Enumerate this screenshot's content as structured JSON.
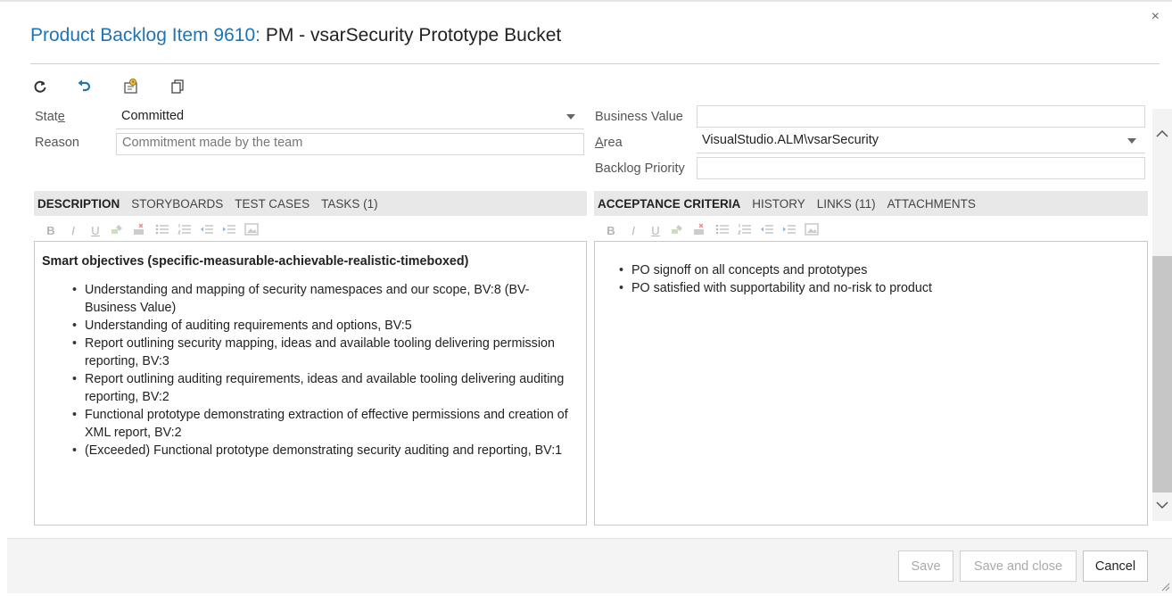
{
  "dialog": {
    "title_link": "Product Backlog Item 9610:",
    "title_rest": " PM - vsarSecurity Prototype Bucket",
    "close_glyph": "×"
  },
  "toolbar": {
    "icons": [
      "refresh-icon",
      "undo-icon",
      "history-icon",
      "copy-icon"
    ]
  },
  "fields": {
    "state": {
      "label_pre": "Stat",
      "label_accel": "e",
      "value": "Committed"
    },
    "reason": {
      "label": "Reason",
      "value": "Commitment made by the team"
    },
    "business_value": {
      "label": "Business Value",
      "value": ""
    },
    "area": {
      "label_accel": "A",
      "label_post": "rea",
      "value": "VisualStudio.ALM\\vsarSecurity"
    },
    "backlog_priority": {
      "label": "Backlog Priority",
      "value": ""
    }
  },
  "left_tabs": [
    "DESCRIPTION",
    "STORYBOARDS",
    "TEST CASES",
    "TASKS (1)"
  ],
  "right_tabs": [
    "ACCEPTANCE CRITERIA",
    "HISTORY",
    "LINKS (11)",
    "ATTACHMENTS"
  ],
  "format_toolbar": [
    "B",
    "I",
    "U",
    "highlight-icon",
    "clear-format-icon",
    "bullet-list-icon",
    "numbered-list-icon",
    "outdent-icon",
    "indent-icon",
    "image-icon"
  ],
  "description": {
    "heading": "Smart objectives (specific-measurable-achievable-realistic-timeboxed)",
    "items": [
      "Understanding and mapping of security namespaces and our scope, BV:8 (BV-Business Value)",
      "Understanding of auditing requirements and options, BV:5",
      "Report outlining security mapping, ideas and available tooling delivering permission reporting, BV:3",
      "Report outlining auditing requirements, ideas and available tooling delivering auditing reporting, BV:2",
      "Functional prototype demonstrating extraction of effective permissions and creation of XML report, BV:2",
      "(Exceeded) Functional prototype demonstrating security auditing and reporting, BV:1"
    ]
  },
  "acceptance_criteria": {
    "items": [
      "PO signoff on all concepts and prototypes",
      "PO satisfied with supportability and no-risk to product"
    ]
  },
  "footer": {
    "save": "Save",
    "save_close": "Save and close",
    "cancel": "Cancel"
  },
  "colors": {
    "accent": "#1e74b4",
    "tab_bar": "#e8e8e8"
  }
}
